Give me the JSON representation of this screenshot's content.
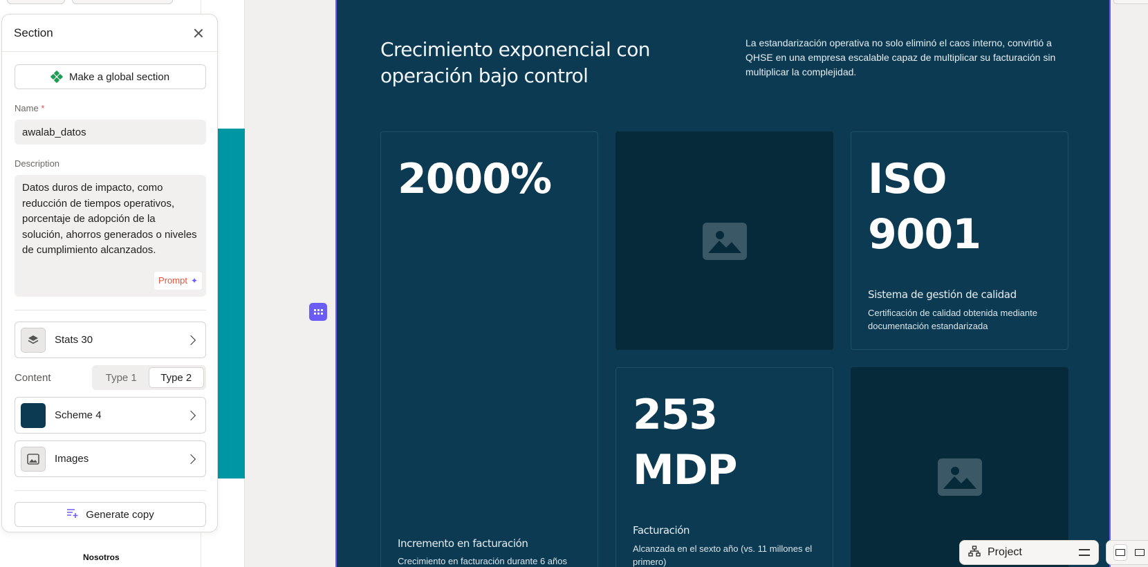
{
  "panel": {
    "title": "Section",
    "global_button_label": "Make a global section",
    "name_label": "Name",
    "name_required_marker": "*",
    "name_value": "awalab_datos",
    "description_label": "Description",
    "description_value": "Datos duros de impacto, como reducción de tiempos operativos, porcentaje de adopción de la solución, ahorros generados o niveles de cumplimiento alcanzados.",
    "prompt_label": "Prompt",
    "layout_row_label": "Stats 30",
    "content_label": "Content",
    "content_options": [
      "Type 1",
      "Type 2"
    ],
    "content_selected": "Type 2",
    "scheme_row_label": "Scheme 4",
    "scheme_color": "#0b3a52",
    "images_row_label": "Images",
    "generate_copy_label": "Generate copy"
  },
  "sidebar_footer": "Nosotros",
  "preview": {
    "title": "Crecimiento exponencial con operación bajo control",
    "description": "La estandarización operativa no solo eliminó el caos interno, convirtió a QHSE en una empresa escalable capaz de multiplicar su facturación sin multiplicar la complejidad.",
    "stats": [
      {
        "value": "2000%",
        "title": "Incremento en facturación",
        "subtitle": "Crecimiento en facturación durante 6 años"
      },
      {
        "value": "ISO 9001",
        "title": "Sistema de gestión de calidad",
        "subtitle": "Certificación de calidad obtenida mediante documentación estandarizada"
      },
      {
        "value": "253 MDP",
        "title": "Facturación",
        "subtitle": "Alcanzada en el sexto año (vs. 11 millones el primero)"
      }
    ]
  },
  "bottom_bar": {
    "project_label": "Project"
  },
  "colors": {
    "accent": "#6b5cf6",
    "teal": "#0097a4",
    "preview_bg": "#0b3a52",
    "image_card_bg": "#072a3a"
  }
}
